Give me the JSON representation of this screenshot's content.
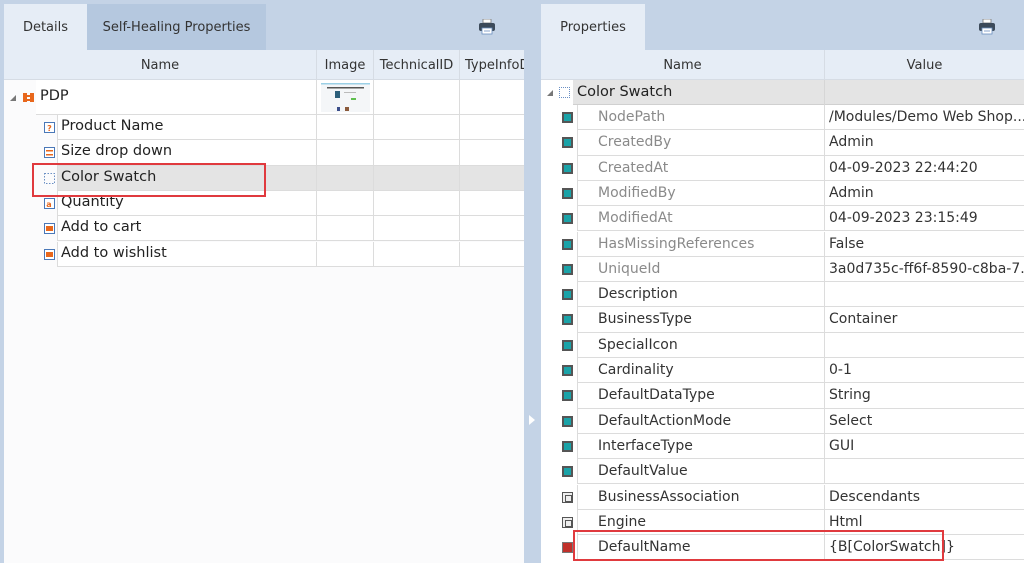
{
  "left_panel": {
    "tabs": [
      {
        "label": "Details",
        "active": true
      },
      {
        "label": "Self-Healing Properties",
        "active": false
      }
    ],
    "print_icon": "printer-icon",
    "columns": [
      "Name",
      "Image",
      "TechnicalID",
      "TypeInfoD"
    ],
    "root": {
      "label": "PDP",
      "icon": "module-icon",
      "expanded": true,
      "has_image_thumbnail": true
    },
    "children": [
      {
        "label": "Product Name",
        "icon": "textbox-icon"
      },
      {
        "label": "Size drop down",
        "icon": "combobox-icon"
      },
      {
        "label": "Color Swatch",
        "icon": "container-icon",
        "selected": true,
        "highlighted": true
      },
      {
        "label": "Quantity",
        "icon": "numeric-input-icon"
      },
      {
        "label": "Add to cart",
        "icon": "button-icon"
      },
      {
        "label": "Add to wishlist",
        "icon": "button-icon"
      }
    ]
  },
  "right_panel": {
    "tabs": [
      {
        "label": "Properties",
        "active": true
      }
    ],
    "print_icon": "printer-icon",
    "columns": [
      "Name",
      "Value"
    ],
    "group": {
      "label": "Color Swatch",
      "expanded": true
    },
    "properties": [
      {
        "name": "NodePath",
        "value": "/Modules/Demo Web Shop...",
        "readonly": true,
        "icon": "std"
      },
      {
        "name": "CreatedBy",
        "value": "Admin",
        "readonly": true,
        "icon": "std"
      },
      {
        "name": "CreatedAt",
        "value": "04-09-2023 22:44:20",
        "readonly": true,
        "icon": "std"
      },
      {
        "name": "ModifiedBy",
        "value": "Admin",
        "readonly": true,
        "icon": "std"
      },
      {
        "name": "ModifiedAt",
        "value": "04-09-2023 23:15:49",
        "readonly": true,
        "icon": "std"
      },
      {
        "name": "HasMissingReferences",
        "value": "False",
        "readonly": true,
        "icon": "std"
      },
      {
        "name": "UniqueId",
        "value": "3a0d735c-ff6f-8590-c8ba-7...",
        "readonly": true,
        "icon": "std"
      },
      {
        "name": "Description",
        "value": "",
        "readonly": false,
        "icon": "std"
      },
      {
        "name": "BusinessType",
        "value": "Container",
        "readonly": false,
        "icon": "std"
      },
      {
        "name": "SpecialIcon",
        "value": "",
        "readonly": false,
        "icon": "std"
      },
      {
        "name": "Cardinality",
        "value": "0-1",
        "readonly": false,
        "icon": "std"
      },
      {
        "name": "DefaultDataType",
        "value": "String",
        "readonly": false,
        "icon": "std"
      },
      {
        "name": "DefaultActionMode",
        "value": "Select",
        "readonly": false,
        "icon": "std"
      },
      {
        "name": "InterfaceType",
        "value": "GUI",
        "readonly": false,
        "icon": "std"
      },
      {
        "name": "DefaultValue",
        "value": "",
        "readonly": false,
        "icon": "std"
      },
      {
        "name": "BusinessAssociation",
        "value": "Descendants",
        "readonly": false,
        "icon": "calc"
      },
      {
        "name": "Engine",
        "value": "Html",
        "readonly": false,
        "icon": "calc"
      },
      {
        "name": "DefaultName",
        "value": "{B[ColorSwatch]}",
        "readonly": false,
        "icon": "red",
        "highlighted": true
      }
    ]
  },
  "colors": {
    "chrome": "#c4d3e6",
    "header": "#e6edf6",
    "highlight_border": "#e03a3e",
    "selected_row": "#e4e4e4",
    "property_icon": "#1aa3a8",
    "module_icon": "#e8671c"
  }
}
